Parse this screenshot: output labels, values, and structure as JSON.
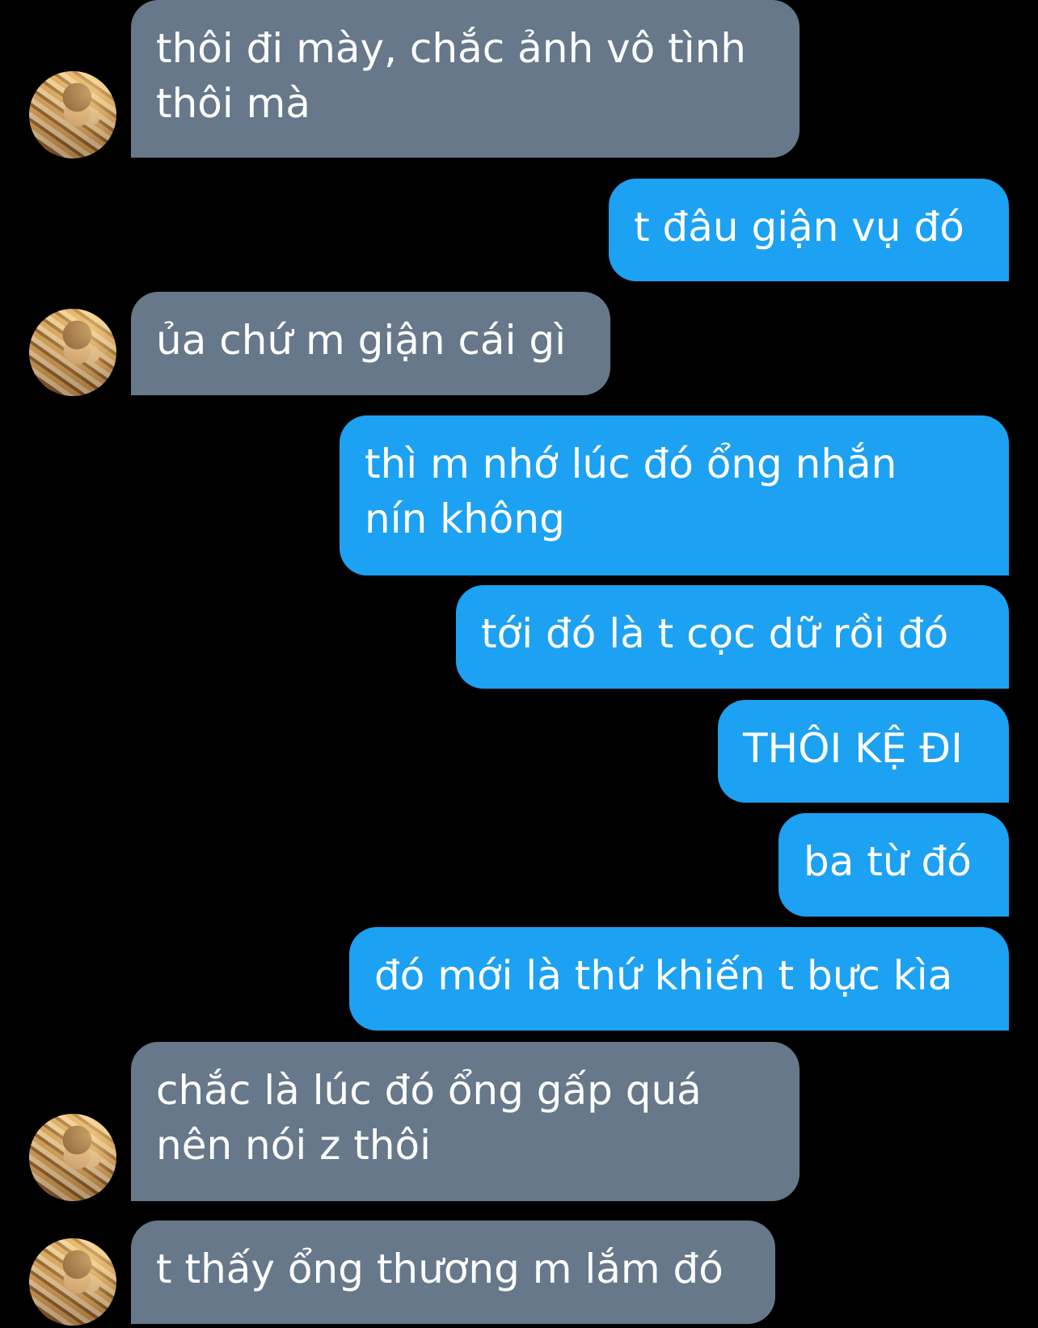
{
  "colors": {
    "background": "#000000",
    "incoming_bubble": "#66788a",
    "outgoing_bubble": "#1da1f2",
    "text": "#ffffff"
  },
  "messages": [
    {
      "direction": "incoming",
      "text": "thôi đi mày, chắc ảnh vô tình\nthôi mà",
      "avatar": "contact-avatar"
    },
    {
      "direction": "outgoing",
      "text": "t đâu giận vụ đó"
    },
    {
      "direction": "incoming",
      "text": "ủa chứ m giận cái gì",
      "avatar": "contact-avatar"
    },
    {
      "direction": "outgoing",
      "text": "thì m nhớ lúc đó ổng nhắn\nnín không"
    },
    {
      "direction": "outgoing",
      "text": "tới đó là t cọc dữ rồi đó"
    },
    {
      "direction": "outgoing",
      "text": "THÔI KỆ ĐI"
    },
    {
      "direction": "outgoing",
      "text": "ba từ đó"
    },
    {
      "direction": "outgoing",
      "text": "đó mới là thứ khiến t bực kìa"
    },
    {
      "direction": "incoming",
      "text": "chắc là lúc đó ổng gấp quá\nnên nói z thôi",
      "avatar": "contact-avatar"
    },
    {
      "direction": "incoming",
      "text": "t thấy ổng thương m lắm đó",
      "avatar": "contact-avatar"
    }
  ]
}
